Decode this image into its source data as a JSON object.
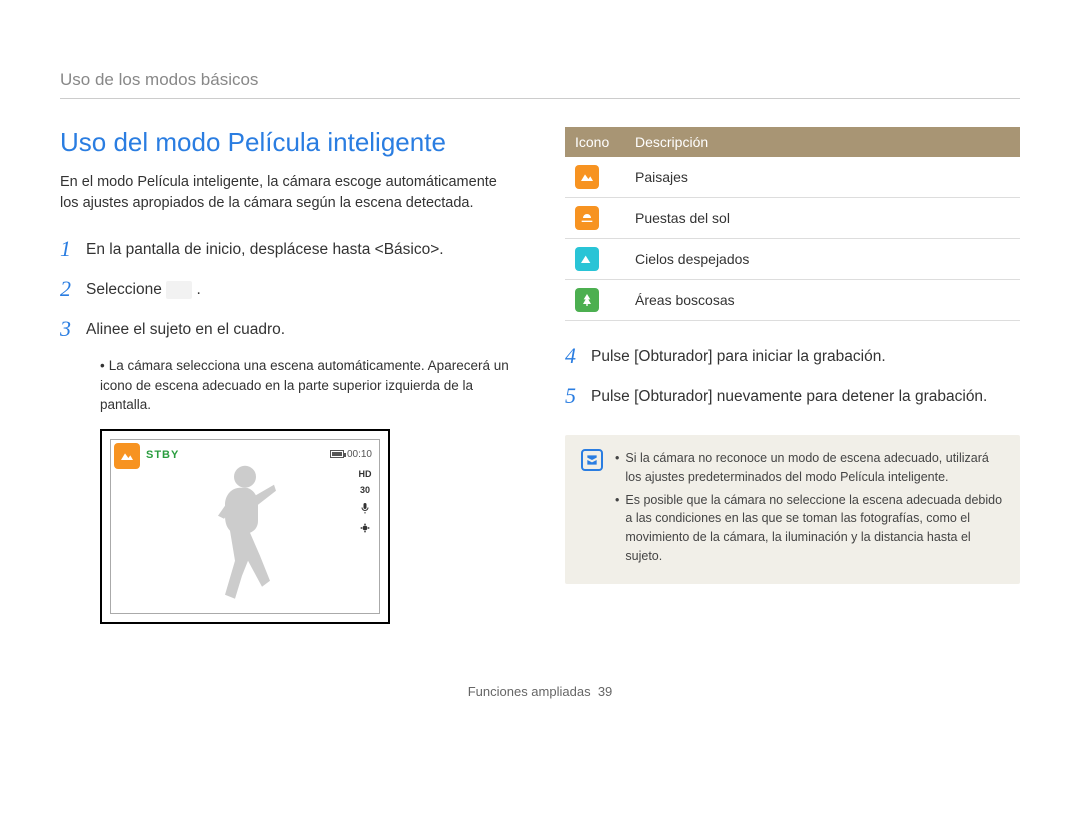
{
  "breadcrumb": "Uso de los modos básicos",
  "heading": "Uso del modo Película inteligente",
  "intro": "En el modo Película inteligente, la cámara escoge automáticamente los ajustes apropiados de la cámara según la escena detectada.",
  "steps": {
    "s1": {
      "num": "1",
      "text": "En la pantalla de inicio, desplácese hasta <Básico>."
    },
    "s2": {
      "num": "2",
      "text": "Seleccione "
    },
    "s3": {
      "num": "3",
      "text": "Alinee el sujeto en el cuadro."
    },
    "s3sub": "La cámara selecciona una escena automáticamente. Aparecerá un icono de escena adecuado en la parte superior izquierda de la pantalla.",
    "s4": {
      "num": "4",
      "text": "Pulse [Obturador] para iniciar la grabación."
    },
    "s5": {
      "num": "5",
      "text": "Pulse [Obturador] nuevamente para detener la grabación."
    }
  },
  "preview": {
    "stby": "STBY",
    "time": "00:10",
    "hd": "HD",
    "fps": "30"
  },
  "table": {
    "h1": "Icono",
    "h2": "Descripción",
    "r1": "Paisajes",
    "r2": "Puestas del sol",
    "r3": "Cielos despejados",
    "r4": "Áreas boscosas"
  },
  "notes": {
    "n1": "Si la cámara no reconoce un modo de escena adecuado, utilizará los ajustes predeterminados del modo Película inteligente.",
    "n2": "Es posible que la cámara no seleccione la escena adecuada debido a las condiciones en las que se toman las fotografías, como el movimiento de la cámara, la iluminación y la distancia hasta el sujeto."
  },
  "footer": {
    "label": "Funciones ampliadas",
    "page": "39"
  }
}
